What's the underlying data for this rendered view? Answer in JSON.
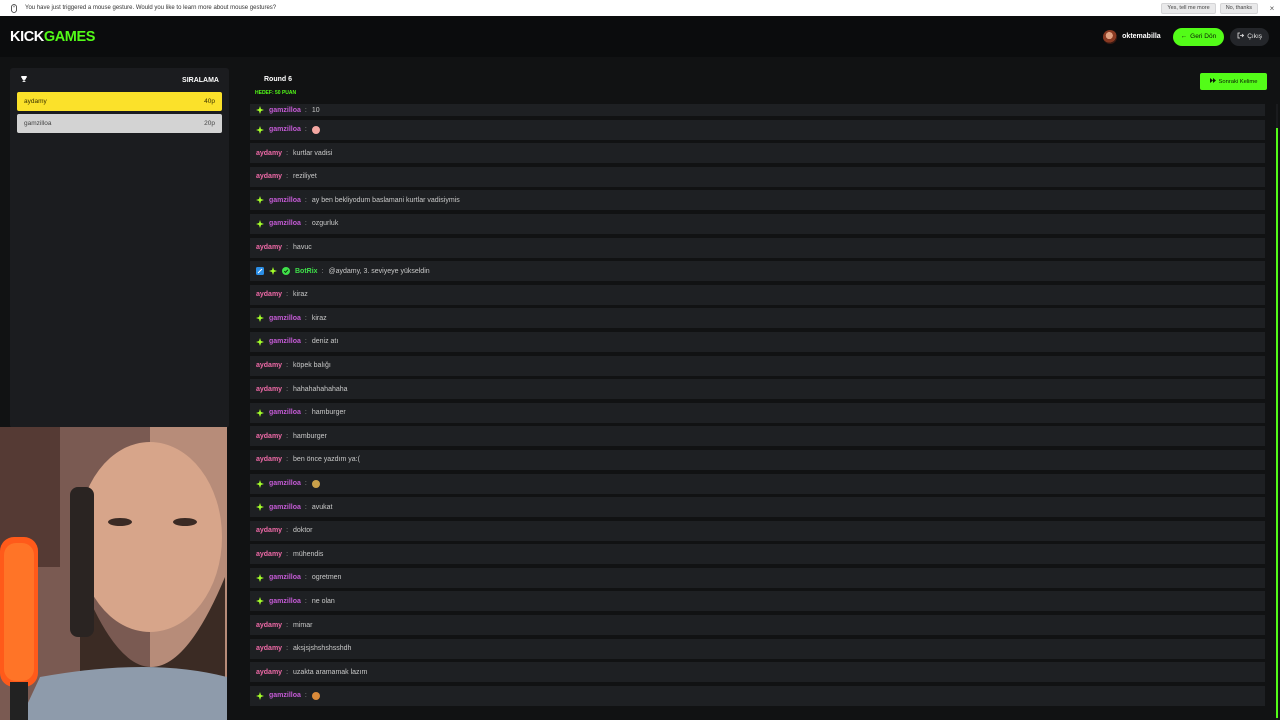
{
  "notification": {
    "message": "You have just triggered a mouse gesture. Would you like to learn more about mouse gestures?",
    "yes_label": "Yes, tell me more",
    "no_label": "No, thanks",
    "close_label": "×"
  },
  "topbar": {
    "logo_part1": "KICK",
    "logo_part2": "GAMES",
    "username": "oktemabilla",
    "back_label": "Geri Dön",
    "logout_label": "Çıkış"
  },
  "leaderboard": {
    "title": "SIRALAMA",
    "entries": [
      {
        "name": "aydamy",
        "score": "40p"
      },
      {
        "name": "gamzilloa",
        "score": "20p"
      }
    ]
  },
  "game": {
    "round": "Round 6",
    "target": "HEDEF: 50 PUAN",
    "next_label": "Sonraki Kelime"
  },
  "chat": {
    "messages": [
      {
        "user": "gamzilloa",
        "text": "10"
      },
      {
        "user": "gamzilloa",
        "text": ""
      },
      {
        "user": "aydamy",
        "text": "kurtlar vadisi"
      },
      {
        "user": "aydamy",
        "text": "reziliyet"
      },
      {
        "user": "gamzilloa",
        "text": "ay ben bekliyodum baslamani kurtlar vadisiymis"
      },
      {
        "user": "gamzilloa",
        "text": "ozgurluk"
      },
      {
        "user": "aydamy",
        "text": "havuc"
      },
      {
        "user": "BotRix",
        "text": "@aydamy, 3. seviyeye yükseldin"
      },
      {
        "user": "aydamy",
        "text": "kiraz"
      },
      {
        "user": "gamzilloa",
        "text": "kiraz"
      },
      {
        "user": "gamzilloa",
        "text": "deniz atı"
      },
      {
        "user": "aydamy",
        "text": "köpek balığı"
      },
      {
        "user": "aydamy",
        "text": "hahahahahahaha"
      },
      {
        "user": "gamzilloa",
        "text": "hamburger"
      },
      {
        "user": "aydamy",
        "text": "hamburger"
      },
      {
        "user": "aydamy",
        "text": "ben önce yazdım ya:("
      },
      {
        "user": "gamzilloa",
        "text": ""
      },
      {
        "user": "gamzilloa",
        "text": "avukat"
      },
      {
        "user": "aydamy",
        "text": "doktor"
      },
      {
        "user": "aydamy",
        "text": "mühendis"
      },
      {
        "user": "gamzilloa",
        "text": "ogretmen"
      },
      {
        "user": "gamzilloa",
        "text": "ne olan"
      },
      {
        "user": "aydamy",
        "text": "mimar"
      },
      {
        "user": "aydamy",
        "text": "aksjsjshshshsshdh"
      },
      {
        "user": "aydamy",
        "text": "uzakta aramamak lazım"
      },
      {
        "user": "gamzilloa",
        "text": ""
      }
    ]
  },
  "colors": {
    "accent": "#53fc18",
    "first_place": "#fbe12a",
    "aydamy": "#f06aa8",
    "gamzilloa": "#c55bd6",
    "botrix": "#3fe04a"
  }
}
